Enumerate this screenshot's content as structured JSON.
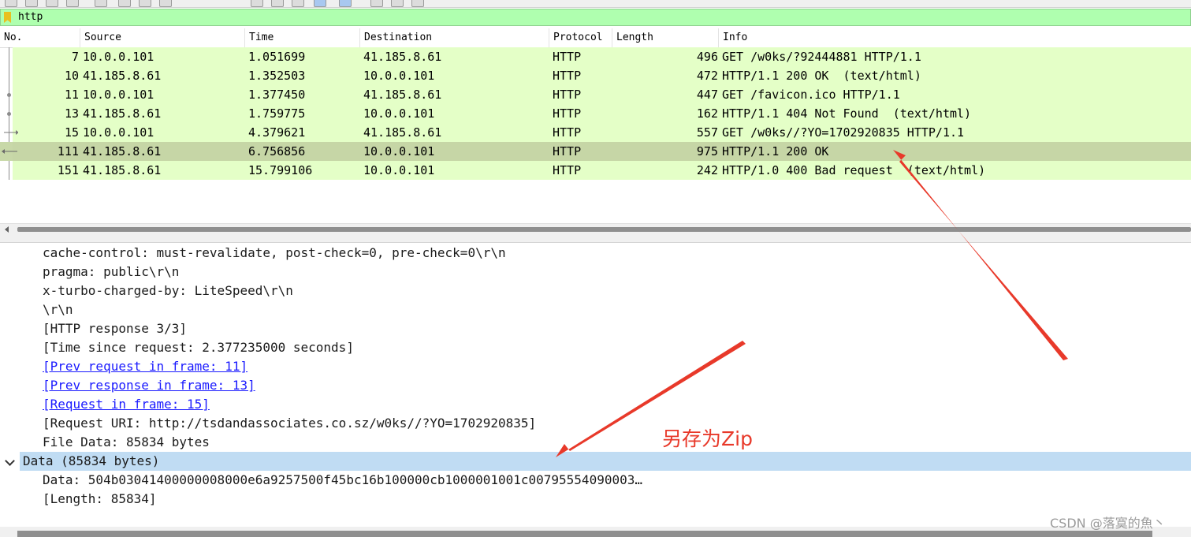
{
  "filter": {
    "value": "http"
  },
  "packet_list": {
    "columns": [
      "No.",
      "Source",
      "Time",
      "Destination",
      "Protocol",
      "Length",
      "Info"
    ],
    "rows": [
      {
        "no": "7",
        "source": "10.0.0.101",
        "time": "1.051699",
        "destination": "41.185.8.61",
        "protocol": "HTTP",
        "length": "496",
        "info": "GET /w0ks/?92444881 HTTP/1.1"
      },
      {
        "no": "10",
        "source": "41.185.8.61",
        "time": "1.352503",
        "destination": "10.0.0.101",
        "protocol": "HTTP",
        "length": "472",
        "info": "HTTP/1.1 200 OK  (text/html)"
      },
      {
        "no": "11",
        "source": "10.0.0.101",
        "time": "1.377450",
        "destination": "41.185.8.61",
        "protocol": "HTTP",
        "length": "447",
        "info": "GET /favicon.ico HTTP/1.1"
      },
      {
        "no": "13",
        "source": "41.185.8.61",
        "time": "1.759775",
        "destination": "10.0.0.101",
        "protocol": "HTTP",
        "length": "162",
        "info": "HTTP/1.1 404 Not Found  (text/html)"
      },
      {
        "no": "15",
        "source": "10.0.0.101",
        "time": "4.379621",
        "destination": "41.185.8.61",
        "protocol": "HTTP",
        "length": "557",
        "info": "GET /w0ks//?YO=1702920835 HTTP/1.1"
      },
      {
        "no": "111",
        "source": "41.185.8.61",
        "time": "6.756856",
        "destination": "10.0.0.101",
        "protocol": "HTTP",
        "length": "975",
        "info": "HTTP/1.1 200 OK"
      },
      {
        "no": "151",
        "source": "41.185.8.61",
        "time": "15.799106",
        "destination": "10.0.0.101",
        "protocol": "HTTP",
        "length": "242",
        "info": "HTTP/1.0 400 Bad request  (text/html)"
      }
    ],
    "selected_no": "111"
  },
  "details": {
    "lines": [
      "cache-control: must-revalidate, post-check=0, pre-check=0\\r\\n",
      "pragma: public\\r\\n",
      "x-turbo-charged-by: LiteSpeed\\r\\n",
      "\\r\\n",
      "[HTTP response 3/3]",
      "[Time since request: 2.377235000 seconds]"
    ],
    "links": [
      "[Prev request in frame: 11]",
      "[Prev response in frame: 13]",
      "[Request in frame: 15]"
    ],
    "request_uri": "[Request URI: http://tsdandassociates.co.sz/w0ks//?YO=1702920835]",
    "file_data": "File Data: 85834 bytes",
    "data_node": "Data (85834 bytes)",
    "data_value": "Data: 504b03041400000008000e6a9257500f45bc16b100000cb1000001001c00795554090003…",
    "data_length": "[Length: 85834]"
  },
  "annotation": {
    "text": "另存为Zip",
    "color": "#e8392a"
  },
  "watermark": "CSDN @落寞的魚丶",
  "colors": {
    "filter_bg": "#afffaf",
    "row_bg": "#e4ffc7",
    "selected_bg": "#c6d6a6",
    "data_row_bg": "#c0dcf3"
  }
}
